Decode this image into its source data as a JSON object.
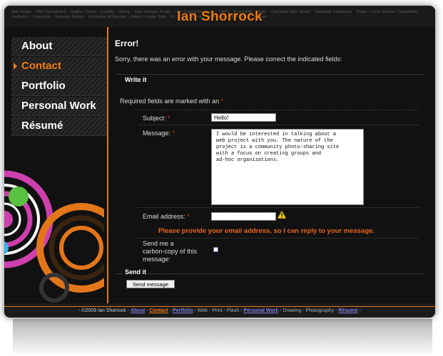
{
  "header": {
    "title": "Ian Shorrock",
    "tagline": "Web Design · Web Development · Graphic Design · Usability · Identity · User Interface Design · User Experience Design · LAMP · Accessibility · AJAX · Cascading Style Sheets · Standards Compliance · Drupal · Cross Browser Compatibility · Aesthetics · Community · Semantic Markup · Information Architecture · Adobe Creative Suite · Art · 3-D Modeling · Actionscript · Open Source Software"
  },
  "nav": {
    "items": [
      {
        "label": "About",
        "active": false
      },
      {
        "label": "Contact",
        "active": true
      },
      {
        "label": "Portfolio",
        "active": false
      },
      {
        "label": "Personal Work",
        "active": false
      },
      {
        "label": "Résumé",
        "active": false
      }
    ]
  },
  "content": {
    "error_heading": "Error!",
    "error_text": "Sorry, there was an error with your message. Please correct the indicated fields:",
    "write_legend": "Write it",
    "required_note": "Required fields are marked with an",
    "required_marker": "*",
    "subject_label": "Subject:",
    "subject_value": "Hello!",
    "message_label": "Message:",
    "message_value": "I would be interested in talking about a\nweb project with you. The nature of the\nproject is a community photo-sharing site\nwith a focus on creating groups and\nad-hoc organizations.",
    "email_label": "Email address:",
    "email_value": "",
    "email_error": "Please provide your email address, so I can reply to your message.",
    "cc_label_1": "Send me a",
    "cc_label_2": "carbon-copy of this",
    "cc_label_3": "message:",
    "send_legend": "Send it",
    "send_button": "Send message"
  },
  "footer": {
    "copyright": "- ©2009 Ian Shorrock -",
    "links": [
      {
        "label": "About",
        "style": "link"
      },
      {
        "label": "Contact",
        "style": "active"
      },
      {
        "label": "Portfolio",
        "style": "link"
      },
      {
        "label": "Web",
        "style": "plain"
      },
      {
        "label": "Print",
        "style": "plain"
      },
      {
        "label": "Flash",
        "style": "plain"
      },
      {
        "label": "Personal Work",
        "style": "link"
      },
      {
        "label": "Drawing",
        "style": "plain"
      },
      {
        "label": "Photography",
        "style": "plain"
      },
      {
        "label": "Résumé",
        "style": "link"
      }
    ]
  },
  "colors": {
    "accent": "#f07c10",
    "error": "#e8661c",
    "background": "#111111"
  }
}
